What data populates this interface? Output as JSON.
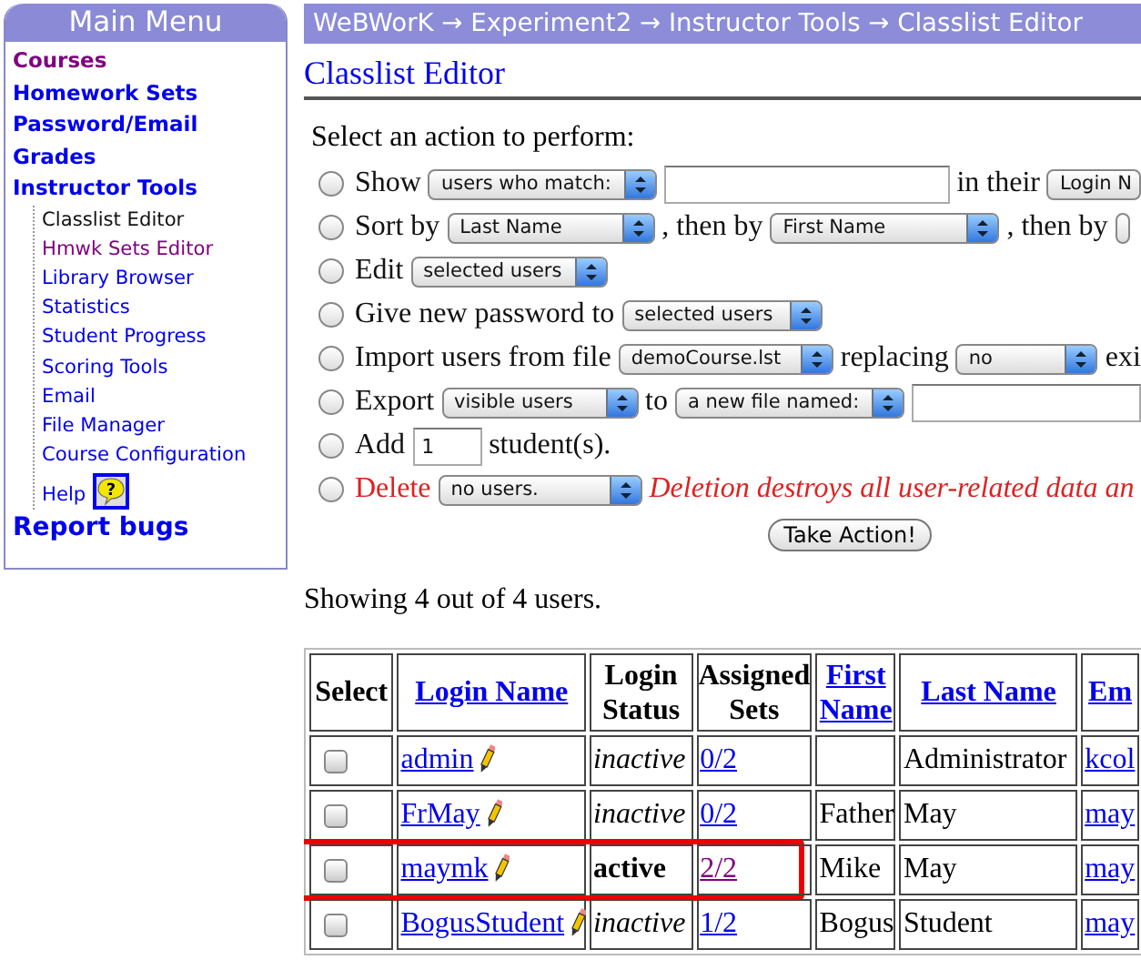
{
  "sidebar": {
    "title": "Main Menu",
    "items": [
      {
        "label": "Courses",
        "kind": "top",
        "visited": true,
        "current": false
      },
      {
        "label": "Homework Sets",
        "kind": "top",
        "visited": false,
        "current": false
      },
      {
        "label": "Password/Email",
        "kind": "top",
        "visited": false,
        "current": false
      },
      {
        "label": "Grades",
        "kind": "top",
        "visited": false,
        "current": false
      },
      {
        "label": "Instructor Tools",
        "kind": "top",
        "visited": false,
        "current": false,
        "children": [
          {
            "label": "Classlist Editor",
            "kind": "sub",
            "visited": false,
            "current": true
          },
          {
            "label": "Hmwk Sets Editor",
            "kind": "sub",
            "visited": true,
            "current": false
          },
          {
            "label": "Library Browser",
            "kind": "sub",
            "visited": false,
            "current": false
          },
          {
            "label": "Statistics",
            "kind": "sub",
            "visited": false,
            "current": false
          },
          {
            "label": "Student Progress",
            "kind": "sub",
            "visited": false,
            "current": false
          },
          {
            "label": "Scoring Tools",
            "kind": "sub",
            "visited": false,
            "current": false
          },
          {
            "label": "Email",
            "kind": "sub",
            "visited": false,
            "current": false
          },
          {
            "label": "File Manager",
            "kind": "sub",
            "visited": false,
            "current": false
          },
          {
            "label": "Course Configuration",
            "kind": "sub",
            "visited": false,
            "current": false
          },
          {
            "label": "Help",
            "kind": "help",
            "visited": false,
            "current": false,
            "icon_glyph": "?"
          }
        ]
      },
      {
        "label": "Report bugs",
        "kind": "big",
        "visited": false,
        "current": false
      }
    ]
  },
  "breadcrumb": "WeBWorK → Experiment2 → Instructor Tools → Classlist Editor",
  "title": "Classlist Editor",
  "prompt": "Select an action to perform:",
  "actions": [
    {
      "selected": false,
      "danger": false,
      "parts": [
        {
          "kind": "text",
          "text": "Show"
        },
        {
          "kind": "select",
          "value": "users who match:"
        },
        {
          "kind": "input"
        },
        {
          "kind": "text",
          "text": "in their"
        },
        {
          "kind": "select",
          "value": "Login N"
        }
      ]
    },
    {
      "selected": false,
      "danger": false,
      "parts": [
        {
          "kind": "text",
          "text": "Sort by"
        },
        {
          "kind": "select",
          "value": "Last Name"
        },
        {
          "kind": "text",
          "text": ", then by"
        },
        {
          "kind": "select",
          "value": "First Name"
        },
        {
          "kind": "text",
          "text": ", then by"
        },
        {
          "kind": "select"
        }
      ]
    },
    {
      "selected": false,
      "danger": false,
      "parts": [
        {
          "kind": "text",
          "text": "Edit"
        },
        {
          "kind": "select",
          "value": "selected users"
        }
      ]
    },
    {
      "selected": false,
      "danger": false,
      "parts": [
        {
          "kind": "text",
          "text": "Give new password to"
        },
        {
          "kind": "select",
          "value": "selected users"
        }
      ]
    },
    {
      "selected": false,
      "danger": false,
      "parts": [
        {
          "kind": "text",
          "text": "Import users from file"
        },
        {
          "kind": "select",
          "value": "demoCourse.lst"
        },
        {
          "kind": "text",
          "text": "replacing"
        },
        {
          "kind": "select",
          "value": "no"
        },
        {
          "kind": "text",
          "text": "exi"
        }
      ]
    },
    {
      "selected": false,
      "danger": false,
      "parts": [
        {
          "kind": "text",
          "text": "Export"
        },
        {
          "kind": "select",
          "value": "visible users"
        },
        {
          "kind": "text",
          "text": "to"
        },
        {
          "kind": "select",
          "value": "a new file named:"
        },
        {
          "kind": "input"
        }
      ]
    },
    {
      "selected": false,
      "danger": false,
      "parts": [
        {
          "kind": "text",
          "text": "Add"
        },
        {
          "kind": "input",
          "value": "1"
        },
        {
          "kind": "text",
          "text": "student(s)."
        }
      ]
    },
    {
      "selected": false,
      "danger": true,
      "parts": [
        {
          "kind": "text",
          "text": "Delete"
        },
        {
          "kind": "select",
          "value": "no users."
        },
        {
          "kind": "note",
          "text": "Deletion destroys all user-related data an"
        }
      ]
    }
  ],
  "submit": "Take Action!",
  "summary": "Showing 4 out of 4 users.",
  "table": {
    "columns": [
      {
        "label": "Select",
        "link": false
      },
      {
        "label": "Login Name",
        "link": true
      },
      {
        "label": "Login Status",
        "link": false
      },
      {
        "label": "Assigned Sets",
        "link": false
      },
      {
        "label": "First Name",
        "link": true
      },
      {
        "label": "Last Name",
        "link": true
      },
      {
        "label": "Em",
        "link": true
      }
    ],
    "rows": [
      {
        "checked": false,
        "login": "admin",
        "active": false,
        "status": "inactive",
        "sets": "0/2",
        "sets_visited": false,
        "first": "",
        "last": "Administrator",
        "email": "kcol",
        "highlighted": false
      },
      {
        "checked": false,
        "login": "FrMay",
        "active": false,
        "status": "inactive",
        "sets": "0/2",
        "sets_visited": false,
        "first": "Father",
        "last": "May",
        "email": "may",
        "highlighted": false
      },
      {
        "checked": false,
        "login": "maymk",
        "active": true,
        "status": "active",
        "sets": "2/2",
        "sets_visited": true,
        "first": "Mike",
        "last": "May",
        "email": "may",
        "highlighted": true
      },
      {
        "checked": false,
        "login": "BogusStudent",
        "active": false,
        "status": "inactive",
        "sets": "1/2",
        "sets_visited": false,
        "first": "Bogus",
        "last": "Student",
        "email": "may",
        "highlighted": false
      }
    ]
  }
}
